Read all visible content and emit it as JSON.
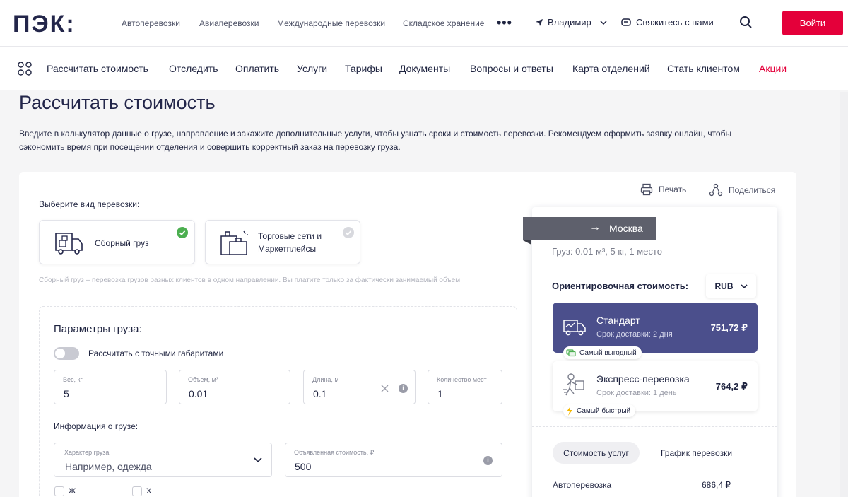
{
  "header": {
    "logo_text": "ПЭК:",
    "links": [
      "Автоперевозки",
      "Авиаперевозки",
      "Международные перевозки",
      "Складское хранение"
    ],
    "more": "•••",
    "city": "Владимир",
    "contact": "Свяжитесь с нами",
    "login": "Войти"
  },
  "nav": {
    "items": [
      "Рассчитать стоимость",
      "Отследить",
      "Оплатить",
      "Услуги",
      "Тарифы",
      "Документы",
      "Вопросы и ответы",
      "Карта отделений",
      "Стать клиентом"
    ],
    "promo": "Акции"
  },
  "page": {
    "title": "Рассчитать стоимость",
    "intro_line1": "Введите в калькулятор данные о грузе, направление и закажите дополнительные услуги, чтобы узнать сроки и стоимость перевозки. Рекомендуем оформить заявку онлайн, чтобы",
    "intro_line2": "сэкономить время при посещении отделения и совершить корректный заказ на перевозку груза."
  },
  "actions": {
    "print": "Печать",
    "share": "Поделиться"
  },
  "transport": {
    "label": "Выберите вид перевозки:",
    "options": [
      {
        "line1": "Сборный груз",
        "line2": "",
        "selected": true
      },
      {
        "line1": "Торговые сети и",
        "line2": "Маркетплейсы",
        "selected": false
      }
    ],
    "hint": "Сборный груз – перевозка грузов разных клиентов в одном направлении. Вы платите только за фактически занимаемый объем."
  },
  "params": {
    "title": "Параметры груза:",
    "toggle_label": "Рассчитать с точными габаритами",
    "toggle_on": false,
    "fields": [
      {
        "label": "Вес, кг",
        "value": "5"
      },
      {
        "label": "Объем, м³",
        "value": "0.01"
      },
      {
        "label": "Длина, м",
        "value": "0.1"
      },
      {
        "label": "Количество мест",
        "value": "1"
      }
    ],
    "info_title": "Информация о грузе:",
    "nature": {
      "label": "Характер груза",
      "placeholder": "Например, одежда"
    },
    "declared": {
      "label": "Объявленная стоимость, ₽",
      "value": "500"
    },
    "checks": [
      "Ж",
      "Х"
    ]
  },
  "summary": {
    "destination": "Москва",
    "cargo_text": "Груз: 0.01 м³, 5 кг, 1 место",
    "estimate_title": "Ориентировочная стоимость:",
    "currency": "RUB",
    "options": [
      {
        "name": "Стандарт",
        "term": "Срок доставки: 2 дня",
        "price": "751,72 ₽",
        "badge": "Самый выгодный"
      },
      {
        "name": "Экспресс-перевозка",
        "term": "Срок доставки: 1 день",
        "price": "764,2 ₽",
        "badge": "Самый быстрый"
      }
    ],
    "tabs": [
      "Стоимость услуг",
      "График перевозки"
    ],
    "line_items": [
      {
        "name": "Автоперевозка",
        "price": "686,4 ₽"
      }
    ]
  },
  "colors": {
    "brand": "#e4003a",
    "accent": "#4b4f8c",
    "dark": "#23264a"
  }
}
